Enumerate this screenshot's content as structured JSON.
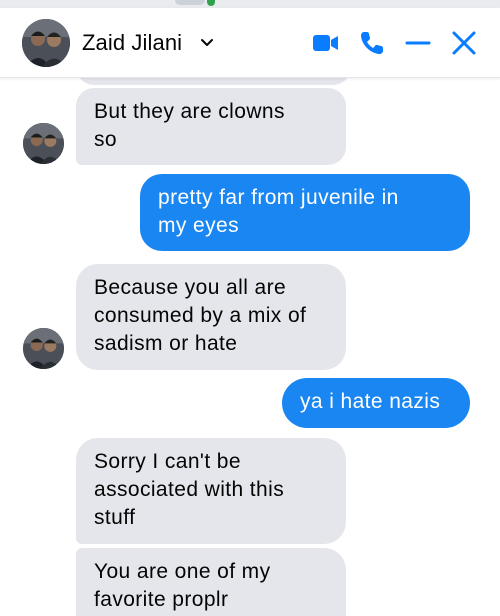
{
  "header": {
    "contact_name": "Zaid Jilani",
    "icons": [
      "video-call-icon",
      "phone-call-icon",
      "minimize-icon",
      "close-icon"
    ]
  },
  "colors": {
    "accent": "#0a7cff",
    "outgoing_bubble": "#1a86f2",
    "incoming_bubble": "#e4e6eb"
  },
  "messages": [
    {
      "side": "incoming",
      "text": "But they are clowns\nso"
    },
    {
      "side": "outgoing",
      "text": "pretty far from juvenile in\nmy eyes"
    },
    {
      "side": "incoming",
      "text": "Because you all are\nconsumed by a mix of\nsadism or hate"
    },
    {
      "side": "outgoing",
      "text": "ya i hate nazis"
    },
    {
      "side": "incoming",
      "text": "Sorry I can't be\nassociated with this\nstuff"
    },
    {
      "side": "incoming",
      "text": "You are one of my\nfavorite proplr"
    }
  ]
}
